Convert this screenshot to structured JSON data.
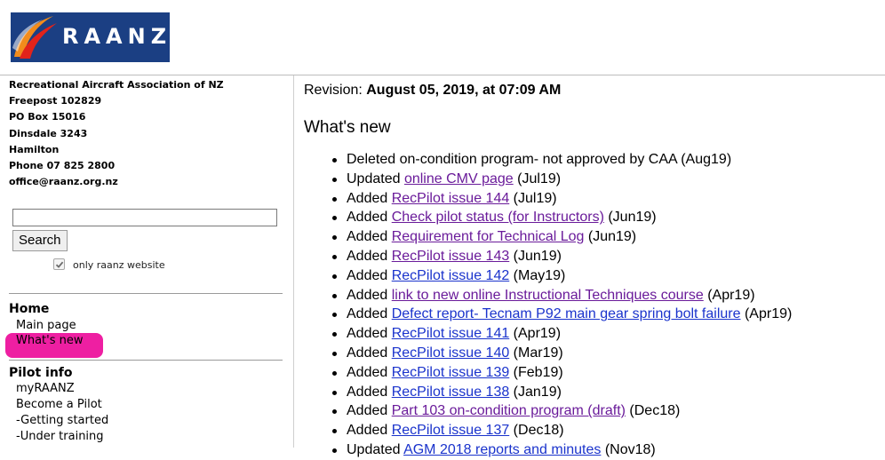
{
  "header": {
    "logo_text": "RAANZ"
  },
  "sidebar": {
    "org_lines": [
      "Recreational Aircraft Association of NZ",
      "Freepost 102829",
      "PO Box 15016",
      "Dinsdale 3243",
      "Hamilton",
      "Phone 07 825 2800",
      "office@raanz.org.nz"
    ],
    "search": {
      "value": "",
      "button_label": "Search",
      "checkbox_label": "only raanz website",
      "checkbox_checked": true
    },
    "nav": {
      "home_heading": "Home",
      "home_items": [
        "Main page",
        "What's new"
      ],
      "pilot_heading": "Pilot info",
      "pilot_items": [
        "myRAANZ",
        "Become a Pilot",
        "-Getting started",
        "-Under training"
      ]
    }
  },
  "main": {
    "revision_prefix": "Revision: ",
    "revision_date": "August 05, 2019, at 07:09 AM",
    "heading": "What's new",
    "items": [
      {
        "pre": "Deleted on-condition program- not approved by CAA (Aug19)",
        "link": "",
        "post": "",
        "link_color": ""
      },
      {
        "pre": "Updated ",
        "link": "online CMV page",
        "post": " (Jul19)",
        "link_color": "purple"
      },
      {
        "pre": "Added ",
        "link": "RecPilot issue 144",
        "post": " (Jul19)",
        "link_color": "purple"
      },
      {
        "pre": "Added ",
        "link": "Check pilot status (for Instructors)",
        "post": " (Jun19)",
        "link_color": "purple"
      },
      {
        "pre": "Added ",
        "link": "Requirement for Technical Log",
        "post": " (Jun19)",
        "link_color": "purple"
      },
      {
        "pre": "Added ",
        "link": "RecPilot issue 143",
        "post": " (Jun19)",
        "link_color": "purple"
      },
      {
        "pre": "Added ",
        "link": "RecPilot issue 142",
        "post": " (May19)",
        "link_color": "blue"
      },
      {
        "pre": "Added ",
        "link": "link to new online Instructional Techniques course",
        "post": " (Apr19)",
        "link_color": "purple"
      },
      {
        "pre": "Added ",
        "link": "Defect report- Tecnam P92 main gear spring bolt failure",
        "post": " (Apr19)",
        "link_color": "blue"
      },
      {
        "pre": "Added ",
        "link": "RecPilot issue 141",
        "post": " (Apr19)",
        "link_color": "blue"
      },
      {
        "pre": "Added ",
        "link": "RecPilot issue 140",
        "post": " (Mar19)",
        "link_color": "blue"
      },
      {
        "pre": "Added ",
        "link": "RecPilot issue 139",
        "post": " (Feb19)",
        "link_color": "blue"
      },
      {
        "pre": "Added ",
        "link": "RecPilot issue 138",
        "post": " (Jan19)",
        "link_color": "blue"
      },
      {
        "pre": "Added ",
        "link": "Part 103 on-condition program (draft)",
        "post": " (Dec18)",
        "link_color": "purple"
      },
      {
        "pre": "Added ",
        "link": "RecPilot issue 137",
        "post": " (Dec18)",
        "link_color": "blue"
      },
      {
        "pre": "Updated ",
        "link": "AGM 2018 reports and minutes",
        "post": " (Nov18)",
        "link_color": "blue"
      }
    ]
  },
  "colors": {
    "logo_bg": "#1b3f83",
    "highlight": "#ee1fa2",
    "link_visited": "#6a1b9a",
    "link": "#1a33cc"
  },
  "icons": {
    "checkbox": "checkmark-icon"
  }
}
